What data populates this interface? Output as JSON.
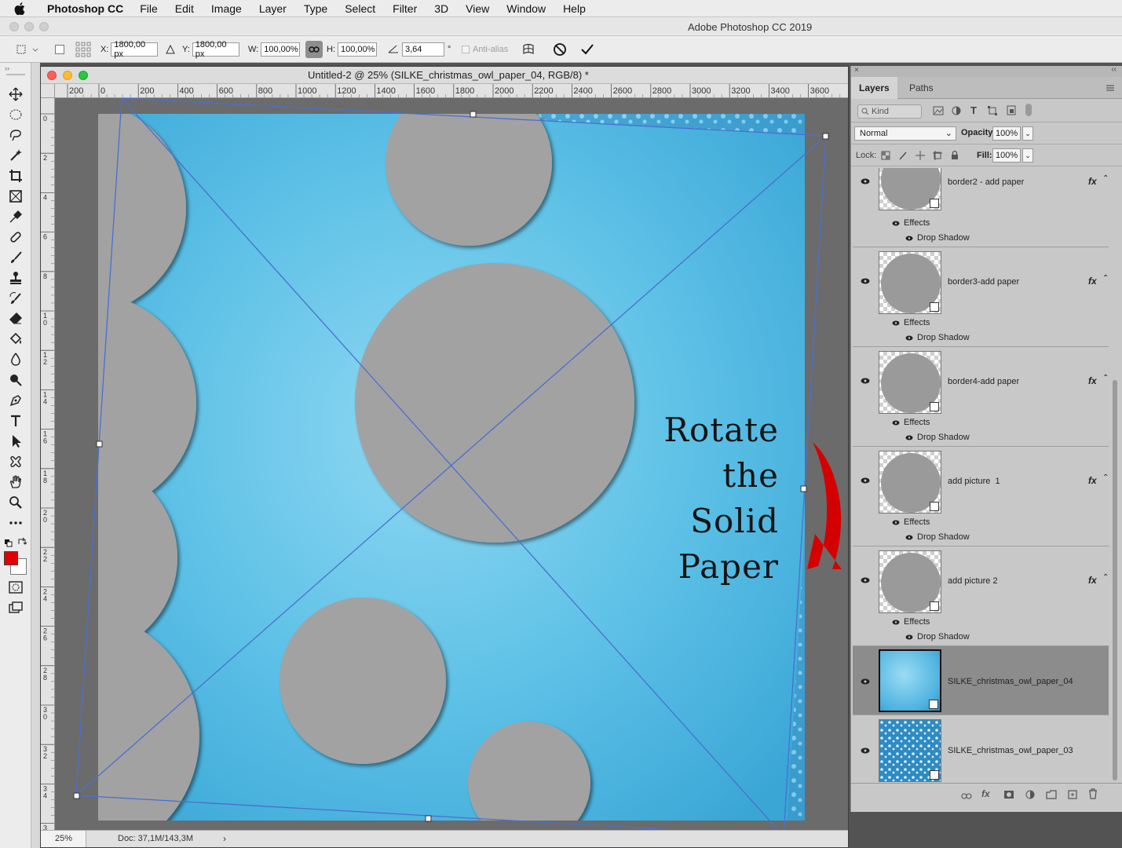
{
  "menubar": {
    "app_name": "Photoshop CC",
    "items": [
      "File",
      "Edit",
      "Image",
      "Layer",
      "Type",
      "Select",
      "Filter",
      "3D",
      "View",
      "Window",
      "Help"
    ]
  },
  "window_title": "Adobe Photoshop CC 2019",
  "options": {
    "x_label": "X:",
    "x_value": "1800,00 px",
    "y_label": "Y:",
    "y_value": "1800,00 px",
    "w_label": "W:",
    "w_value": "100,00%",
    "h_label": "H:",
    "h_value": "100,00%",
    "angle_value": "3,64",
    "angle_unit": "°",
    "antialias_label": "Anti-alias"
  },
  "document": {
    "title": "Untitled-2 @ 25% (SILKE_christmas_owl_paper_04, RGB/8) *",
    "zoom": "25%",
    "doc_info": "Doc: 37,1M/143,3M",
    "hruler_ticks": [
      "200",
      "0",
      "200",
      "400",
      "600",
      "800",
      "1000",
      "1200",
      "1400",
      "1600",
      "1800",
      "2000",
      "2200",
      "2400",
      "2600",
      "2800",
      "3000",
      "3200",
      "3400",
      "3600"
    ],
    "vruler_ticks": [
      "0",
      "2",
      "4",
      "6",
      "8",
      "1 0",
      "1 2",
      "1 4",
      "1 6",
      "1 8",
      "2 0",
      "2 2",
      "2 4",
      "2 6",
      "2 8",
      "3 0",
      "3 2",
      "3 4",
      "3 6"
    ]
  },
  "annotation": {
    "lines": [
      "Rotate",
      "the",
      "Solid",
      "Paper"
    ]
  },
  "colors": {
    "foreground": "#e00000",
    "background": "#ffffff",
    "arrow": "#d40000",
    "paper_blue": "#5bbde4",
    "transform_line": "#5a7fd6"
  },
  "layers_panel": {
    "tabs": [
      "Layers",
      "Paths"
    ],
    "filter_kind": "Kind",
    "blend_mode": "Normal",
    "opacity_label": "Opacity:",
    "opacity_value": "100%",
    "lock_label": "Lock:",
    "fill_label": "Fill:",
    "fill_value": "100%",
    "effects_label": "Effects",
    "drop_shadow_label": "Drop Shadow",
    "fx_label": "fx",
    "layers": [
      {
        "name": "border2 - add paper"
      },
      {
        "name": "border3-add paper"
      },
      {
        "name": "border4-add paper"
      },
      {
        "name": "add picture  1"
      },
      {
        "name": "add picture 2"
      },
      {
        "name": "SILKE_christmas_owl_paper_04"
      },
      {
        "name": "SILKE_christmas_owl_paper_03"
      }
    ]
  }
}
